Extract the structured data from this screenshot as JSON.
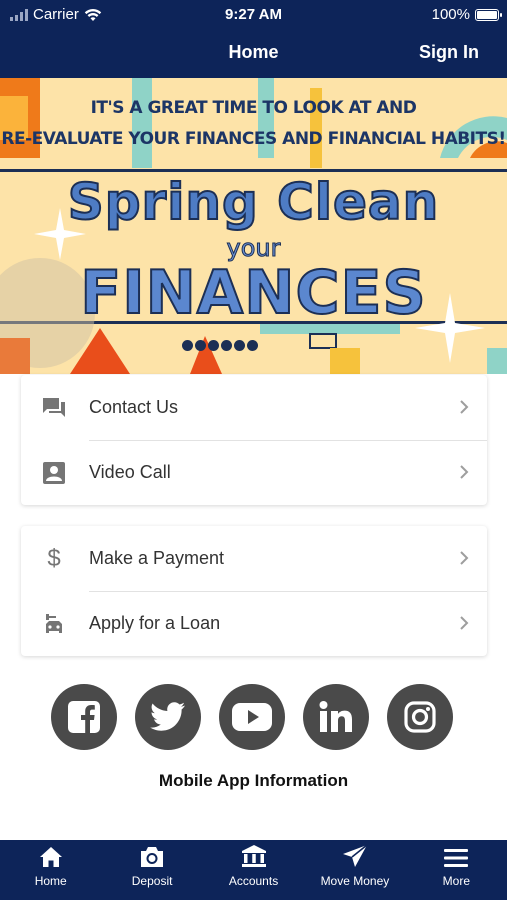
{
  "status_bar": {
    "carrier": "Carrier",
    "time": "9:27 AM",
    "battery": "100%"
  },
  "header": {
    "title": "Home",
    "sign_in": "Sign In"
  },
  "banner": {
    "line1": "IT'S A GREAT TIME TO LOOK AT AND",
    "line2": "RE-EVALUATE YOUR FINANCES AND FINANCIAL HABITS!",
    "title_line1": "Spring Clean",
    "title_line2": "your",
    "title_line3": "FINANCES"
  },
  "cards": [
    {
      "items": [
        {
          "label": "Contact Us",
          "icon": "chat-icon"
        },
        {
          "label": "Video Call",
          "icon": "video-call-icon"
        }
      ]
    },
    {
      "items": [
        {
          "label": "Make a Payment",
          "icon": "dollar-icon"
        },
        {
          "label": "Apply for a Loan",
          "icon": "car-loan-icon"
        }
      ]
    }
  ],
  "social": [
    "facebook-icon",
    "twitter-icon",
    "youtube-icon",
    "linkedin-icon",
    "instagram-icon"
  ],
  "app_info": "Mobile App Information",
  "tabs": [
    {
      "label": "Home",
      "icon": "home-icon"
    },
    {
      "label": "Deposit",
      "icon": "camera-icon"
    },
    {
      "label": "Accounts",
      "icon": "bank-icon"
    },
    {
      "label": "Move Money",
      "icon": "send-icon"
    },
    {
      "label": "More",
      "icon": "menu-icon"
    }
  ],
  "colors": {
    "header_bg": "#0d2459",
    "social_bg": "#4a4a4a",
    "icon_gray": "#757575"
  }
}
